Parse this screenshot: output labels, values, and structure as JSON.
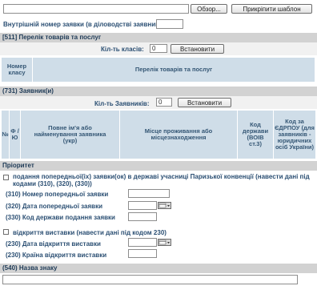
{
  "top": {
    "browse_label": "Обзор...",
    "attach_template_label": "Прикріпити шаблон"
  },
  "internal_number": {
    "label": "Внутрішній номер заявки (в діловодстві заявника):",
    "value": ""
  },
  "goods_section": {
    "title": "[511] Перелік товарів та послуг",
    "classes_count_label": "Кіл-ть класів:",
    "classes_count_value": "0",
    "set_button": "Встановити",
    "col_class_number": "Номер класу",
    "col_goods_list": "Перелік товарів та послуг"
  },
  "applicants_section": {
    "title": "(731) Заявник(и)",
    "count_label": "Кіл-ть Заявників:",
    "count_value": "0",
    "set_button": "Встановити",
    "columns": [
      "№",
      "Ф / Ю",
      "Повне ім'я або найменування заявника (укр)",
      "Місце проживання або місцезнаходження",
      "Код держави (ВОІВ ст.3)",
      "Код за ЄДРПОУ (для заявників - юридичних осіб України)"
    ]
  },
  "priority_section": {
    "title": "Пріоритет",
    "paris_checkbox_label": "подання попередньої(іх) заявки(ок) в державі учасниці Паризької конвенції (навести дані під кодами (310), (320), (330))",
    "field_310_label": "(310) Номер попередньої заявки",
    "field_320_label": "(320) Дата попередньої заявки",
    "field_330_label": "(330) Код держави подання заявки",
    "exhibition_checkbox_label": "відкриття виставки (навести дані під кодом 230)",
    "field_230_date_label": "(230) Дата відкриття виставки",
    "field_230_country_label": "(230) Країна відкриття виставки"
  },
  "mark_name_section": {
    "title": "(540) Назва знаку",
    "value": ""
  },
  "icons": {
    "calendar": "calendar-icon"
  }
}
